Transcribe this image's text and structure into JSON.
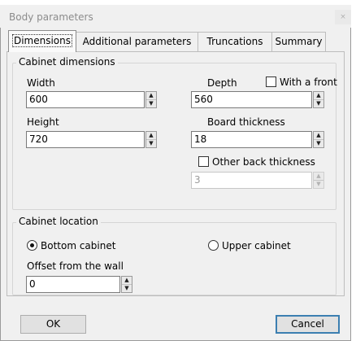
{
  "window": {
    "title": "Body parameters",
    "close_glyph": "×"
  },
  "tabs": [
    {
      "label": "Dimensions",
      "active": true
    },
    {
      "label": "Additional parameters",
      "active": false
    },
    {
      "label": "Truncations",
      "active": false
    },
    {
      "label": "Summary",
      "active": false
    }
  ],
  "dimensions": {
    "group_title": "Cabinet dimensions",
    "width": {
      "label": "Width",
      "value": "600"
    },
    "depth": {
      "label": "Depth",
      "value": "560"
    },
    "with_front": {
      "label": "With a front",
      "checked": false
    },
    "height": {
      "label": "Height",
      "value": "720"
    },
    "board_thickness": {
      "label": "Board thickness",
      "value": "18"
    },
    "other_back": {
      "label": "Other back thickness",
      "checked": false
    },
    "back_thickness": {
      "value": "3",
      "enabled": false
    }
  },
  "location": {
    "group_title": "Cabinet location",
    "bottom": {
      "label": "Bottom cabinet",
      "selected": true
    },
    "upper": {
      "label": "Upper cabinet",
      "selected": false
    },
    "offset": {
      "label": "Offset from the wall",
      "value": "0"
    }
  },
  "buttons": {
    "ok": "OK",
    "cancel": "Cancel"
  },
  "spin_glyphs": {
    "up": "▲",
    "down": "▼"
  }
}
